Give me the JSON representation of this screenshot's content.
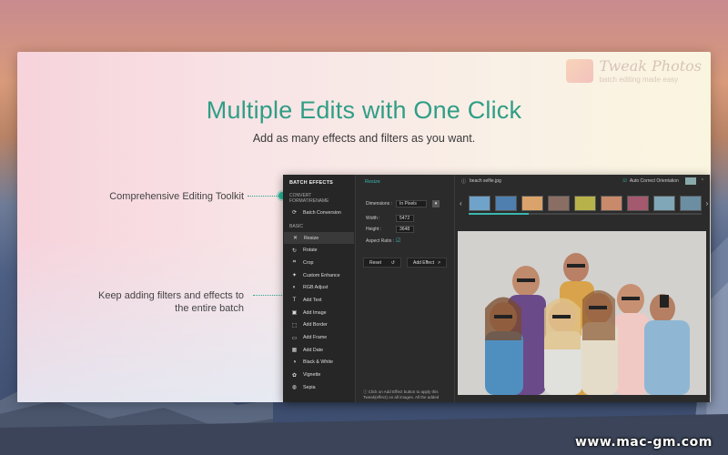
{
  "heading": {
    "title": "Multiple Edits with One Click",
    "subtitle": "Add as many effects and filters as you want."
  },
  "logo": {
    "title": "Tweak Photos",
    "tagline": "batch editing made easy"
  },
  "callouts": [
    {
      "text": "Comprehensive Editing Toolkit"
    },
    {
      "line1": "Keep adding filters and effects to",
      "line2": "the entire batch"
    }
  ],
  "app": {
    "sidebar": {
      "header": "BATCH EFFECTS",
      "section1": "CONVERT FORMAT/RENAME",
      "items_top": [
        {
          "label": "Batch Conversion",
          "icon": "batch-icon"
        }
      ],
      "section2": "BASIC",
      "items": [
        {
          "label": "Resize",
          "icon": "resize-icon",
          "active": true
        },
        {
          "label": "Rotate",
          "icon": "rotate-icon"
        },
        {
          "label": "Crop",
          "icon": "crop-icon"
        },
        {
          "label": "Custom Enhance",
          "icon": "enhance-icon"
        },
        {
          "label": "RGB Adjust",
          "icon": "rgb-icon"
        },
        {
          "label": "Add Text",
          "icon": "text-icon"
        },
        {
          "label": "Add Image",
          "icon": "image-icon"
        },
        {
          "label": "Add Border",
          "icon": "border-icon"
        },
        {
          "label": "Add Frame",
          "icon": "frame-icon"
        },
        {
          "label": "Add Date",
          "icon": "date-icon"
        },
        {
          "label": "Black & White",
          "icon": "bw-icon"
        },
        {
          "label": "Vignette",
          "icon": "vignette-icon"
        },
        {
          "label": "Sepia",
          "icon": "sepia-icon"
        }
      ]
    },
    "panel": {
      "tab": "Resize",
      "dimensions_label": "Dimensions :",
      "dimensions_value": "In Pixels",
      "width_label": "Width :",
      "width_value": "5472",
      "height_label": "Height :",
      "height_value": "3648",
      "aspect_label": "Aspect Ratio :",
      "reset_label": "Reset",
      "add_effect_label": "Add Effect",
      "note": "Click on Add Effect button to apply this Tweak(effect) on all images. All the added"
    },
    "preview": {
      "file_name": "beach selfie.jpg",
      "auto_orient_label": "Auto Correct Orientation"
    },
    "thumb_colors": [
      "#6fa3c9",
      "#4f7fae",
      "#d9a36b",
      "#8b6e63",
      "#b7b34a",
      "#c98a6b",
      "#a45a6e",
      "#7fa7b8",
      "#6b8ea3"
    ]
  },
  "watermark": "www.mac-gm.com"
}
